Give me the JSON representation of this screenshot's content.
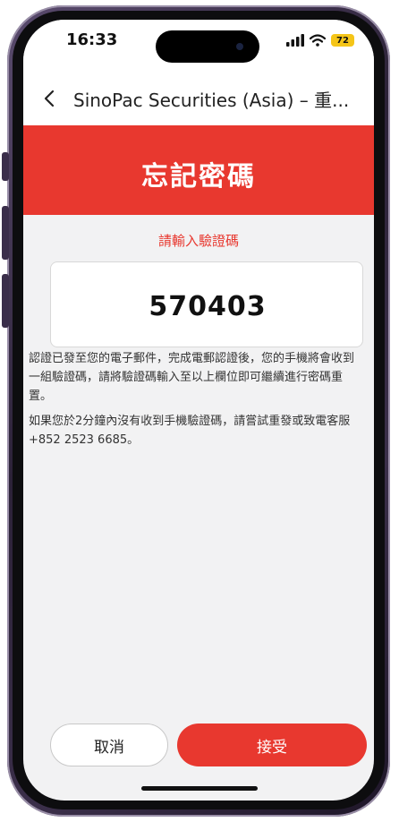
{
  "status_bar": {
    "time": "16:33",
    "battery": "72"
  },
  "nav": {
    "title": "SinoPac Securities (Asia) – 重..."
  },
  "header": {
    "title": "忘記密碼"
  },
  "form": {
    "prompt": "請輸入驗證碼",
    "code": "570403"
  },
  "info": {
    "paragraph1": "認證已發至您的電子郵件，完成電郵認證後，您的手機將會收到一組驗證碼，請將驗證碼輸入至以上欄位即可繼續進行密碼重置。",
    "paragraph2": "如果您於2分鐘內沒有收到手機驗證碼，請嘗試重發或致電客服+852 2523 6685。"
  },
  "buttons": {
    "cancel": "取消",
    "accept": "接受"
  },
  "colors": {
    "accent": "#e8382f",
    "frame": "#3b2f4a"
  }
}
